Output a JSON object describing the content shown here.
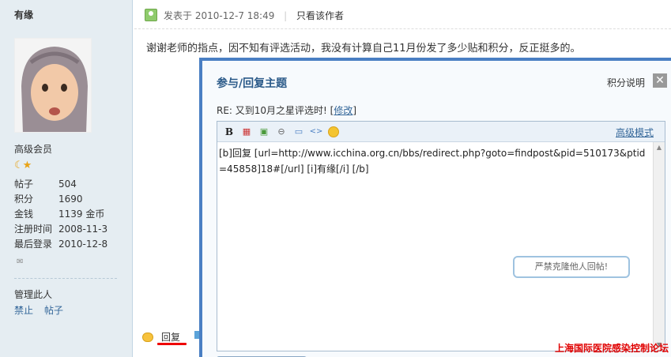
{
  "user": {
    "name": "有缘",
    "rank": "高级会员",
    "stats": [
      {
        "key": "帖子",
        "value": "504"
      },
      {
        "key": "积分",
        "value": "1690"
      },
      {
        "key": "金钱",
        "value": "1139 金币"
      },
      {
        "key": "注册时间",
        "value": "2008-11-3"
      },
      {
        "key": "最后登录",
        "value": "2010-12-8"
      }
    ],
    "manage_label": "管理此人",
    "manage_ban": "禁止",
    "manage_posts": "帖子"
  },
  "post": {
    "posted_prefix": "发表于",
    "posted_time": "2010-12-7 18:49",
    "author_only": "只看该作者",
    "body": "谢谢老师的指点，因不知有评选活动，我没有计算自己11月份发了多少贴和积分，反正挺多的。",
    "reply_label": "回复"
  },
  "dialog": {
    "title": "参与/回复主题",
    "points_label": "积分说明",
    "close_glyph": "✕",
    "subject_prefix": "RE: 又到10月之星评选时! [",
    "subject_edit": "修改",
    "subject_suffix": "]",
    "advanced_mode": "高级模式",
    "toolbar": {
      "bold": "B",
      "color": "▦",
      "image": "▣",
      "link": "⊖",
      "quote": "▭",
      "code": "<>"
    },
    "content": "[b]回复 [url=http://www.icchina.org.cn/bbs/redirect.php?goto=findpost&pid=510173&ptid=45858]18#[/url] [i]有缘[/i] [/b]",
    "tooltip": "严禁克隆他人回帖!"
  },
  "watermark": "上海国际医院感染控制论坛",
  "colors": {
    "sidebar_bg": "#E5EDF2",
    "dialog_border": "#4A7FC3",
    "link": "#336699",
    "watermark": "#E00000",
    "reply_underline": "#EE0000"
  },
  "icons": [
    "pm-icon",
    "post-icon",
    "reply-icon",
    "close-icon",
    "smiley-icon"
  ]
}
